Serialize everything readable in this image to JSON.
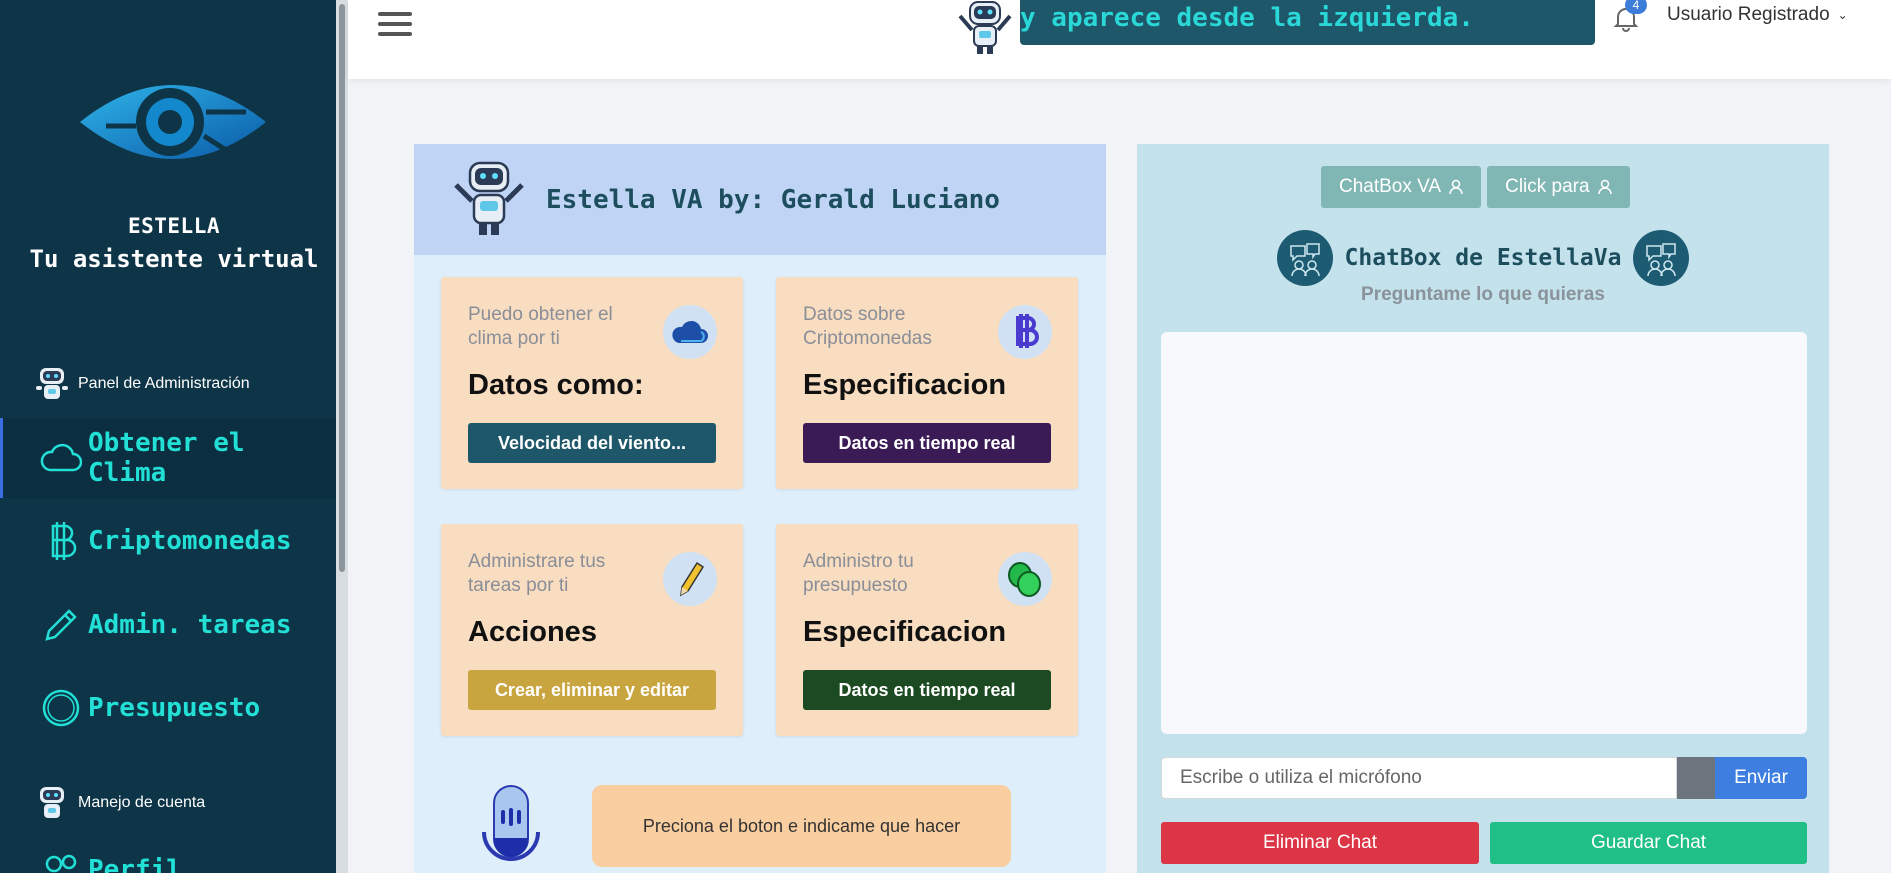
{
  "sidebar": {
    "brand_name": "ESTELLA",
    "brand_tagline": "Tu asistente virtual",
    "section_admin": "Panel de Administración",
    "section_account": "Manejo de cuenta",
    "items": [
      {
        "label": "Obtener el Clima",
        "icon": "cloud-icon",
        "active": true
      },
      {
        "label": "Criptomonedas",
        "icon": "bitcoin-icon",
        "active": false
      },
      {
        "label": "Admin. tareas",
        "icon": "pencil-icon",
        "active": false
      },
      {
        "label": "Presupuesto",
        "icon": "circle-icon",
        "active": false
      },
      {
        "label": "Perfil",
        "icon": "people-icon",
        "active": false
      }
    ]
  },
  "header": {
    "marquee_text": "y aparece desde la izquierda.",
    "notification_count": "4",
    "user_label": "Usuario Registrado"
  },
  "info_panel": {
    "title": "Estella VA by: Gerald Luciano",
    "cards": [
      {
        "label": "Puedo obtener el clima por ti",
        "value": "Datos como:",
        "button": "Velocidad del viento...",
        "icon": "cloud-icon",
        "button_color": "#1e5769"
      },
      {
        "label": "Datos sobre Criptomonedas",
        "value": "Especificacion",
        "button": "Datos en tiempo real",
        "icon": "bitcoin-icon",
        "button_color": "#3a1b56"
      },
      {
        "label": "Administrare tus tareas por ti",
        "value": "Acciones",
        "button": "Crear, eliminar y editar",
        "icon": "pencil-icon",
        "button_color": "#c9a53f"
      },
      {
        "label": "Administro tu presupuesto",
        "value": "Especificacion",
        "button": "Datos en tiempo real",
        "icon": "coins-icon",
        "button_color": "#1c4a22"
      }
    ],
    "mic_message": "Preciona el boton e indicame que hacer"
  },
  "chat": {
    "tab_chatbox": "ChatBox VA",
    "tab_click": "Click para",
    "title": "ChatBox de EstellaVa",
    "subtitle": "Preguntame lo que quieras",
    "input_placeholder": "Escribe o utiliza el micrófono",
    "send_label": "Enviar",
    "delete_label": "Eliminar Chat",
    "save_label": "Guardar Chat"
  },
  "colors": {
    "sidebar_bg": "#0d3547",
    "accent_teal": "#22e0d6",
    "card_bg": "#f8ddc0",
    "chat_panel_bg": "#c4e2ec"
  }
}
